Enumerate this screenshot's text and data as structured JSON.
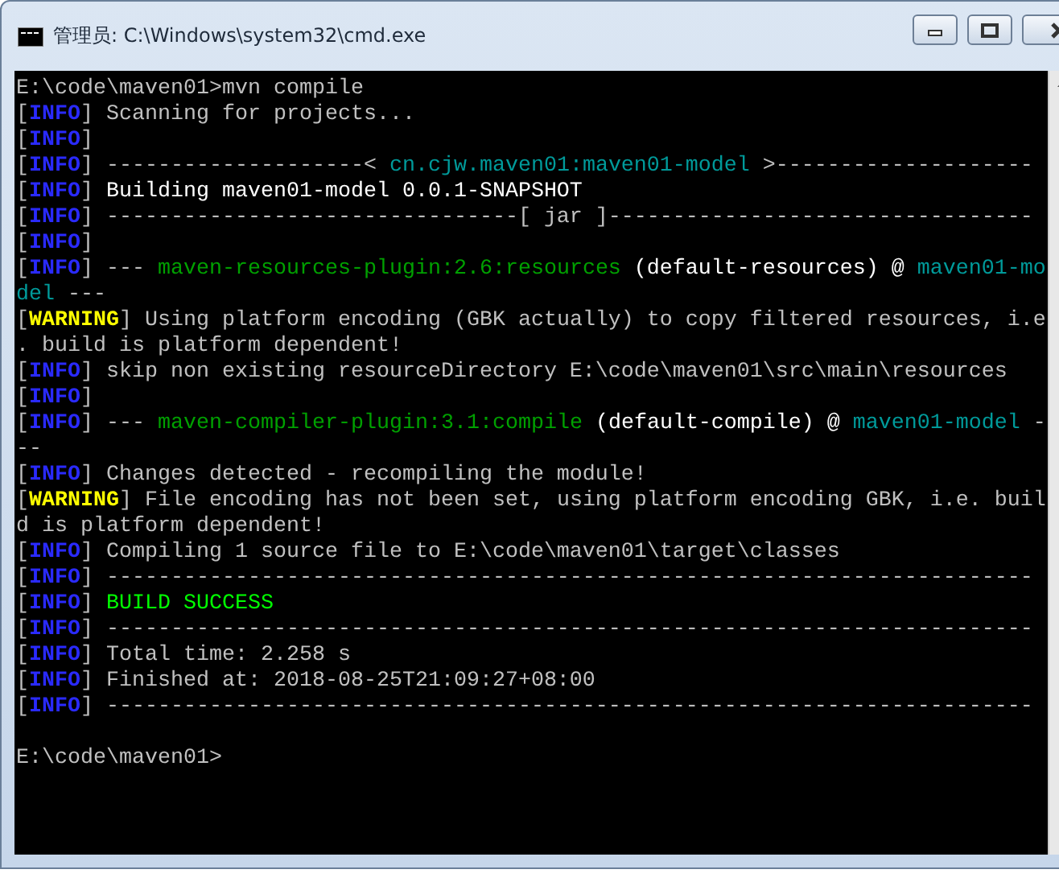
{
  "window": {
    "title": "管理员: C:\\Windows\\system32\\cmd.exe"
  },
  "console": {
    "lines": [
      [
        {
          "kind": "text",
          "text": "E:\\code\\maven01>mvn compile"
        }
      ],
      [
        {
          "kind": "bracket",
          "text": "["
        },
        {
          "kind": "info",
          "text": "INFO"
        },
        {
          "kind": "bracket",
          "text": "] "
        },
        {
          "kind": "text",
          "text": "Scanning for projects..."
        }
      ],
      [
        {
          "kind": "bracket",
          "text": "["
        },
        {
          "kind": "info",
          "text": "INFO"
        },
        {
          "kind": "bracket",
          "text": "]"
        }
      ],
      [
        {
          "kind": "bracket",
          "text": "["
        },
        {
          "kind": "info",
          "text": "INFO"
        },
        {
          "kind": "bracket",
          "text": "] "
        },
        {
          "kind": "text",
          "text": "--------------------< "
        },
        {
          "kind": "artifact",
          "text": "cn.cjw.maven01:maven01-model"
        },
        {
          "kind": "text",
          "text": " >--------------------"
        }
      ],
      [
        {
          "kind": "bracket",
          "text": "["
        },
        {
          "kind": "info",
          "text": "INFO"
        },
        {
          "kind": "bracket",
          "text": "] "
        },
        {
          "kind": "bright",
          "text": "Building maven01-model 0.0.1-SNAPSHOT"
        }
      ],
      [
        {
          "kind": "bracket",
          "text": "["
        },
        {
          "kind": "info",
          "text": "INFO"
        },
        {
          "kind": "bracket",
          "text": "] "
        },
        {
          "kind": "text",
          "text": "--------------------------------[ jar ]---------------------------------"
        }
      ],
      [
        {
          "kind": "bracket",
          "text": "["
        },
        {
          "kind": "info",
          "text": "INFO"
        },
        {
          "kind": "bracket",
          "text": "]"
        }
      ],
      [
        {
          "kind": "bracket",
          "text": "["
        },
        {
          "kind": "info",
          "text": "INFO"
        },
        {
          "kind": "bracket",
          "text": "] "
        },
        {
          "kind": "text",
          "text": "--- "
        },
        {
          "kind": "plugin",
          "text": "maven-resources-plugin:2.6:resources"
        },
        {
          "kind": "bright",
          "text": " (default-resources) @ "
        },
        {
          "kind": "artifact",
          "text": "maven01-mo"
        }
      ],
      [
        {
          "kind": "artifact",
          "text": "del"
        },
        {
          "kind": "text",
          "text": " ---"
        }
      ],
      [
        {
          "kind": "bracket",
          "text": "["
        },
        {
          "kind": "warning",
          "text": "WARNING"
        },
        {
          "kind": "bracket",
          "text": "] "
        },
        {
          "kind": "text",
          "text": "Using platform encoding (GBK actually) to copy filtered resources, i.e"
        }
      ],
      [
        {
          "kind": "text",
          "text": ". build is platform dependent!"
        }
      ],
      [
        {
          "kind": "bracket",
          "text": "["
        },
        {
          "kind": "info",
          "text": "INFO"
        },
        {
          "kind": "bracket",
          "text": "] "
        },
        {
          "kind": "text",
          "text": "skip non existing resourceDirectory E:\\code\\maven01\\src\\main\\resources"
        }
      ],
      [
        {
          "kind": "bracket",
          "text": "["
        },
        {
          "kind": "info",
          "text": "INFO"
        },
        {
          "kind": "bracket",
          "text": "]"
        }
      ],
      [
        {
          "kind": "bracket",
          "text": "["
        },
        {
          "kind": "info",
          "text": "INFO"
        },
        {
          "kind": "bracket",
          "text": "] "
        },
        {
          "kind": "text",
          "text": "--- "
        },
        {
          "kind": "plugin",
          "text": "maven-compiler-plugin:3.1:compile"
        },
        {
          "kind": "bright",
          "text": " (default-compile) @ "
        },
        {
          "kind": "artifact",
          "text": "maven01-model"
        },
        {
          "kind": "text",
          "text": " -"
        }
      ],
      [
        {
          "kind": "text",
          "text": "--"
        }
      ],
      [
        {
          "kind": "bracket",
          "text": "["
        },
        {
          "kind": "info",
          "text": "INFO"
        },
        {
          "kind": "bracket",
          "text": "] "
        },
        {
          "kind": "text",
          "text": "Changes detected - recompiling the module!"
        }
      ],
      [
        {
          "kind": "bracket",
          "text": "["
        },
        {
          "kind": "warning",
          "text": "WARNING"
        },
        {
          "kind": "bracket",
          "text": "] "
        },
        {
          "kind": "text",
          "text": "File encoding has not been set, using platform encoding GBK, i.e. buil"
        }
      ],
      [
        {
          "kind": "text",
          "text": "d is platform dependent!"
        }
      ],
      [
        {
          "kind": "bracket",
          "text": "["
        },
        {
          "kind": "info",
          "text": "INFO"
        },
        {
          "kind": "bracket",
          "text": "] "
        },
        {
          "kind": "text",
          "text": "Compiling 1 source file to E:\\code\\maven01\\target\\classes"
        }
      ],
      [
        {
          "kind": "bracket",
          "text": "["
        },
        {
          "kind": "info",
          "text": "INFO"
        },
        {
          "kind": "bracket",
          "text": "] "
        },
        {
          "kind": "text",
          "text": "------------------------------------------------------------------------"
        }
      ],
      [
        {
          "kind": "bracket",
          "text": "["
        },
        {
          "kind": "info",
          "text": "INFO"
        },
        {
          "kind": "bracket",
          "text": "] "
        },
        {
          "kind": "success",
          "text": "BUILD SUCCESS"
        }
      ],
      [
        {
          "kind": "bracket",
          "text": "["
        },
        {
          "kind": "info",
          "text": "INFO"
        },
        {
          "kind": "bracket",
          "text": "] "
        },
        {
          "kind": "text",
          "text": "------------------------------------------------------------------------"
        }
      ],
      [
        {
          "kind": "bracket",
          "text": "["
        },
        {
          "kind": "info",
          "text": "INFO"
        },
        {
          "kind": "bracket",
          "text": "] "
        },
        {
          "kind": "text",
          "text": "Total time: 2.258 s"
        }
      ],
      [
        {
          "kind": "bracket",
          "text": "["
        },
        {
          "kind": "info",
          "text": "INFO"
        },
        {
          "kind": "bracket",
          "text": "] "
        },
        {
          "kind": "text",
          "text": "Finished at: 2018-08-25T21:09:27+08:00"
        }
      ],
      [
        {
          "kind": "bracket",
          "text": "["
        },
        {
          "kind": "info",
          "text": "INFO"
        },
        {
          "kind": "bracket",
          "text": "] "
        },
        {
          "kind": "text",
          "text": "------------------------------------------------------------------------"
        }
      ],
      {
        "gap_before": true,
        "segments": [
          {
            "kind": "text",
            "text": "E:\\code\\maven01>"
          }
        ]
      }
    ]
  }
}
